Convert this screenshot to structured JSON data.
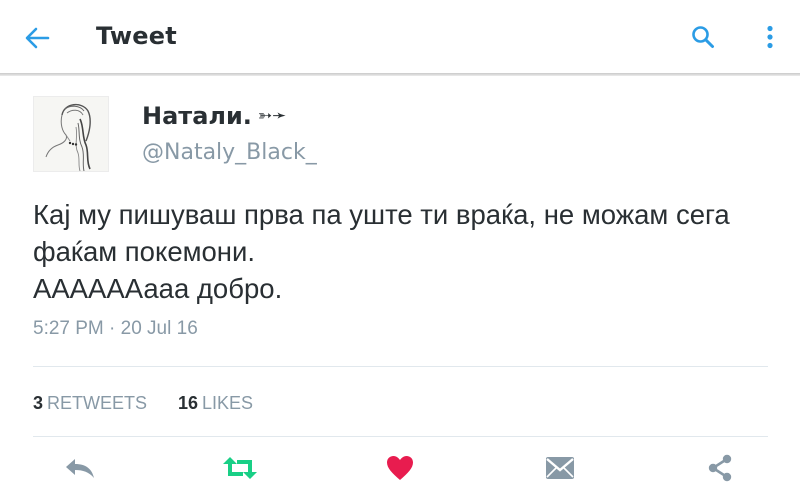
{
  "header": {
    "title": "Tweet",
    "back_icon": "arrow-left-icon",
    "search_icon": "search-icon",
    "more_icon": "more-vertical-icon",
    "accent_color": "#2b9ce5"
  },
  "tweet": {
    "author_name": "Натали.",
    "author_name_suffix": "➳➛",
    "author_handle": "@Nataly_Black_",
    "text_lines": [
      "Кај му пишуваш прва па уште ти враќа, не можам сега",
      "фаќам покемони.",
      "ААААААааа добро."
    ],
    "timestamp": "5:27 PM · 20 Jul 16"
  },
  "stats": {
    "retweets_count": "3",
    "retweets_label": "RETWEETS",
    "likes_count": "16",
    "likes_label": "LIKES"
  },
  "actions": {
    "reply_icon": "reply-icon",
    "retweet_icon": "retweet-icon",
    "like_icon": "heart-icon",
    "dm_icon": "envelope-icon",
    "share_icon": "share-icon",
    "retweet_color": "#19cf86",
    "like_color": "#e81c4f",
    "neutral_color": "#8899a6"
  }
}
